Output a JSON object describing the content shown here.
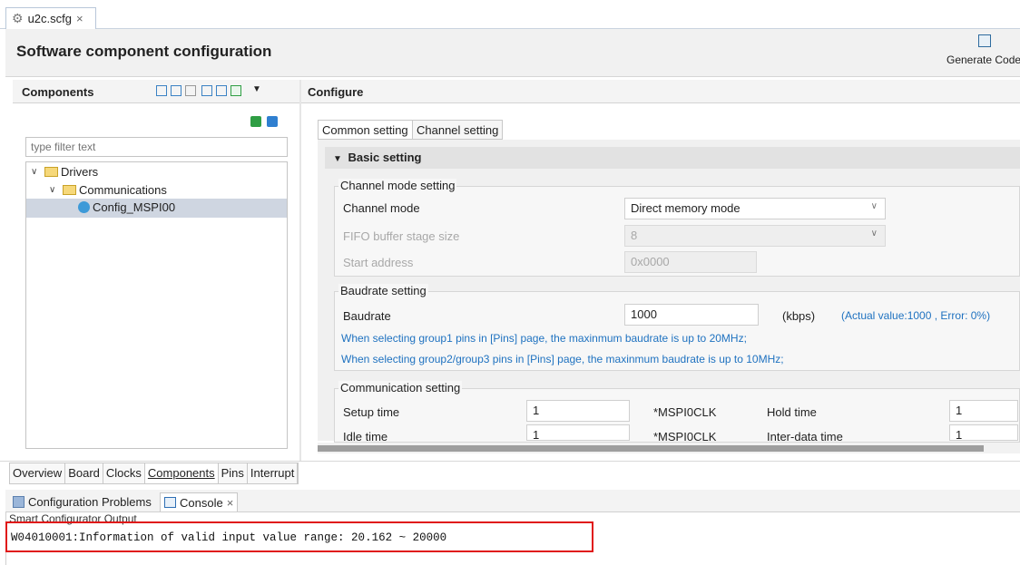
{
  "editor_tab": {
    "label": "u2c.scfg",
    "close": "×"
  },
  "header": {
    "title": "Software component configuration",
    "generate_label": "Generate Code"
  },
  "components_panel": {
    "title": "Components",
    "filter_placeholder": "type filter text",
    "tree": [
      {
        "label": "Drivers",
        "level": 0
      },
      {
        "label": "Communications",
        "level": 1
      },
      {
        "label": "Config_MSPI00",
        "level": 2,
        "selected": true
      }
    ]
  },
  "configure_panel": {
    "title": "Configure",
    "tabs": [
      "Common setting",
      "Channel setting"
    ],
    "section_title": "Basic setting",
    "channel_mode_group": {
      "label": "Channel mode setting",
      "channel_mode_label": "Channel mode",
      "channel_mode_value": "Direct memory mode",
      "fifo_label": "FIFO buffer stage size",
      "fifo_value": "8",
      "start_address_label": "Start address",
      "start_address_value": "0x0000"
    },
    "baudrate_group": {
      "label": "Baudrate setting",
      "baudrate_label": "Baudrate",
      "baudrate_value": "1000",
      "unit": "(kbps)",
      "actual": "(Actual value:1000 , Error: 0%)",
      "note1": "When selecting group1 pins in [Pins] page, the maxinmum baudrate is up to 20MHz;",
      "note2": "When selecting group2/group3 pins in [Pins] page, the maxinmum baudrate is up to 10MHz;"
    },
    "communication_group": {
      "label": "Communication setting",
      "setup_label": "Setup time",
      "setup_value": "1",
      "setup_unit": "*MSPI0CLK",
      "hold_label": "Hold time",
      "hold_value": "1",
      "idle_label": "Idle time",
      "idle_value": "1",
      "idle_unit": "*MSPI0CLK",
      "interdata_label": "Inter-data time",
      "interdata_value": "1"
    }
  },
  "bottom_tabs": [
    "Overview",
    "Board",
    "Clocks",
    "Components",
    "Pins",
    "Interrupt"
  ],
  "console": {
    "tabs": [
      "Configuration Problems",
      "Console"
    ],
    "close": "×",
    "output_title": "Smart Configurator Output",
    "message": "W04010001:Information of valid input value range: 20.162 ~ 20000"
  },
  "colors": {
    "link": "#1f72c0",
    "highlight_border": "#e01818",
    "selection": "#cfd6e1"
  }
}
